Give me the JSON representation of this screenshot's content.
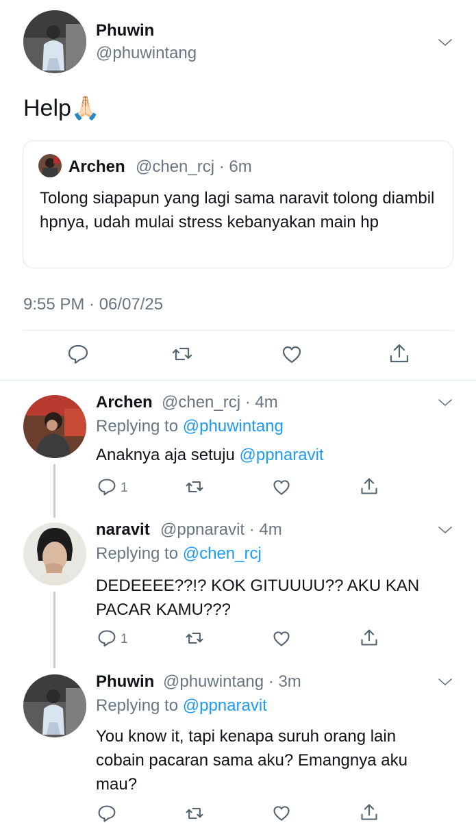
{
  "main_tweet": {
    "author_name": "Phuwin",
    "handle": "@phuwintang",
    "text": "Help🙏🏻",
    "quoted": {
      "author_name": "Archen",
      "handle_time": "@chen_rcj · 6m",
      "text": "Tolong siapapun yang lagi sama naravit tolong diambil hpnya, udah mulai stress kebanyakan main hp"
    },
    "timestamp": "9:55 PM · 06/07/25"
  },
  "replies": [
    {
      "author_name": "Archen",
      "handle_time": "@chen_rcj · 4m",
      "replying_prefix": "Replying to ",
      "replying_to": "@phuwintang",
      "text_before": "Anaknya aja setuju ",
      "mention": "@ppnaravit",
      "reply_count": "1"
    },
    {
      "author_name": "naravit",
      "handle_time": "@ppnaravit · 4m",
      "replying_prefix": "Replying to ",
      "replying_to": "@chen_rcj",
      "text_line1": "DEDEEEE??!? KOK GITUUUU?? AKU KAN",
      "text_line2": "PACAR KAMU???",
      "reply_count": "1"
    },
    {
      "author_name": "Phuwin",
      "handle_time": "@phuwintang · 3m",
      "replying_prefix": "Replying to ",
      "replying_to": "@ppnaravit",
      "text_line1": "You know it, tapi kenapa suruh orang lain",
      "text_line2": "cobain pacaran sama aku? Emangnya aku",
      "text_line3": "mau?"
    }
  ],
  "colors": {
    "text": "#0f1419",
    "muted": "#687684",
    "link": "#1d9bf0",
    "divider": "#e6ecf0"
  }
}
